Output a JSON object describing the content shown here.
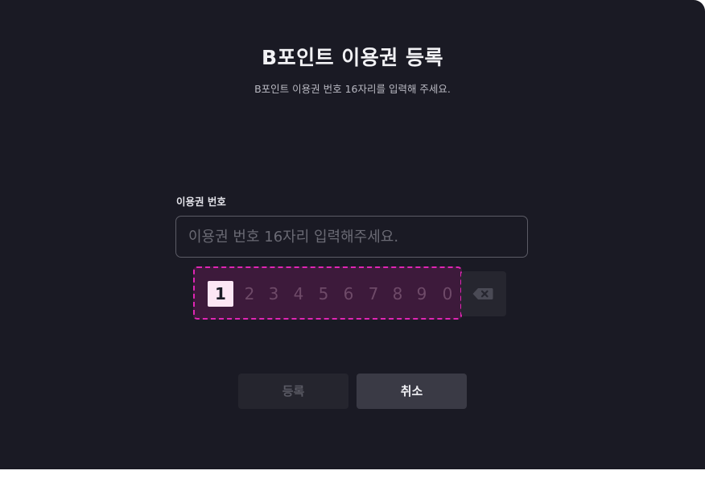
{
  "modal": {
    "title": "B포인트 이용권 등록",
    "subtitle": "B포인트 이용권 번호 16자리를 입력해 주세요."
  },
  "field": {
    "label": "이용권 번호",
    "placeholder": "이용권 번호 16자리 입력해주세요.",
    "value": ""
  },
  "keypad": {
    "keys": [
      "1",
      "2",
      "3",
      "4",
      "5",
      "6",
      "7",
      "8",
      "9",
      "0"
    ],
    "active_key": "1",
    "backspace_icon": "backspace-icon"
  },
  "buttons": {
    "register_label": "등록",
    "cancel_label": "취소"
  },
  "colors": {
    "background": "#1a1a24",
    "highlight_border": "#e025b4",
    "keypad_bg": "#3d1a3b",
    "active_key_bg": "#fce6f4"
  }
}
